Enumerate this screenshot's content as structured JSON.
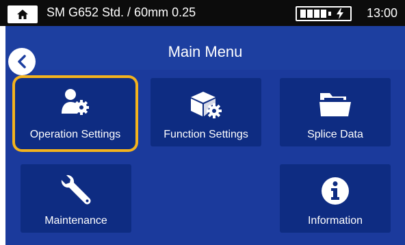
{
  "status": {
    "title": "SM G652 Std. / 60mm 0.25",
    "time": "13:00",
    "home_icon": "home-icon",
    "battery_icon": "battery-charging-icon"
  },
  "header": {
    "title": "Main Menu",
    "back_icon": "chevron-left-icon"
  },
  "menu": {
    "items": [
      {
        "label": "Operation Settings",
        "icon": "user-gear-icon",
        "selected": true
      },
      {
        "label": "Function Settings",
        "icon": "cube-gear-icon",
        "selected": false
      },
      {
        "label": "Splice Data",
        "icon": "folder-icon",
        "selected": false
      },
      {
        "label": "Maintenance",
        "icon": "wrench-icon",
        "selected": false
      },
      {
        "label": "Information",
        "icon": "info-icon",
        "selected": false
      }
    ]
  },
  "colors": {
    "statusbar": "#0c0c0c",
    "titlebar": "#1d3fa0",
    "main_bg": "#1b3a9c",
    "tile_bg": "#0e2c82",
    "selection": "#f4b31d"
  }
}
